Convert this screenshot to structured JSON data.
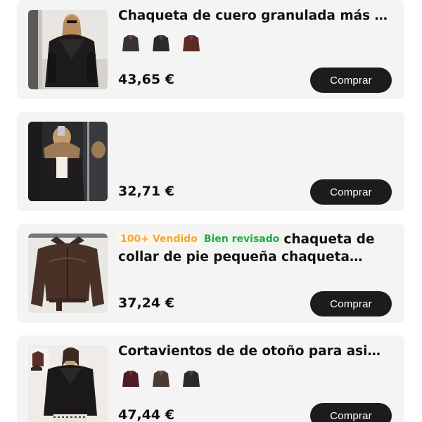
{
  "products": [
    {
      "title": "Chaqueta de cuero granulada más e...",
      "price": "43,65 €",
      "buy_label": "Comprar",
      "swatch_colors": [
        "#3a3230",
        "#2a2a2a",
        "#5b2a24"
      ]
    },
    {
      "title": "",
      "price": "32,71 €",
      "buy_label": "Comprar"
    },
    {
      "tag_sold": "100+ Vendido",
      "tag_checked": "Bien revisado",
      "title": "chaqueta de collar de pie pequeña chaqueta retr...",
      "price": "37,24 €",
      "buy_label": "Comprar"
    },
    {
      "title": "Cortavientos de de otoño para asim...",
      "price": "47,44 €",
      "buy_label": "Comprar",
      "swatch_colors": [
        "#4a1e22",
        "#4d3a32",
        "#2a2a2a"
      ]
    }
  ],
  "colors": {
    "card_bg": "#f4f4f4",
    "button_bg": "#1c1c1c",
    "tag_sold": "#f0a63a",
    "tag_checked": "#2ea44f"
  }
}
